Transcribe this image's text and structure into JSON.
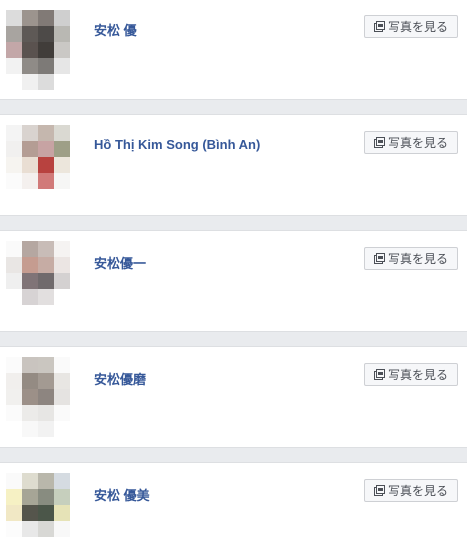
{
  "results": [
    {
      "name": "安松 優",
      "button_label": "写真を見る",
      "avatar_pixels": [
        "#dcdcdc",
        "#9c948e",
        "#817a76",
        "#cfcfcf",
        "#ffffff",
        "#a8a4a0",
        "#5e5956",
        "#4d4a48",
        "#b9b8b3",
        "#ffffff",
        "#c3a7a8",
        "#5a524f",
        "#413d3a",
        "#cac8c5",
        "#ffffff",
        "#f2f2f2",
        "#8f8b87",
        "#7d7a77",
        "#e6e6e6",
        "#ffffff",
        "#ffffff",
        "#f0f0f0",
        "#dcdcdc",
        "#ffffff",
        "#ffffff"
      ]
    },
    {
      "name": "Hồ Thị Kim Song (Bình An)",
      "button_label": "写真を見る",
      "avatar_pixels": [
        "#f4f4f4",
        "#d9d3cf",
        "#c5b7ae",
        "#dad9d2",
        "#ffffff",
        "#f1f0ef",
        "#b49d94",
        "#c7a3a3",
        "#9e9f87",
        "#ffffff",
        "#f6f4f0",
        "#e9ded3",
        "#b8423f",
        "#ece6dc",
        "#ffffff",
        "#fbfbfb",
        "#f4f0ee",
        "#d17a79",
        "#f6f6f5",
        "#ffffff",
        "#ffffff",
        "#ffffff",
        "#ffffff",
        "#ffffff",
        "#ffffff"
      ]
    },
    {
      "name": "安松優一",
      "button_label": "写真を見る",
      "avatar_pixels": [
        "#fafafa",
        "#b5a7a1",
        "#c8bcb7",
        "#f5f3f2",
        "#ffffff",
        "#e9e6e4",
        "#c59c90",
        "#c6aca4",
        "#ebe5e3",
        "#ffffff",
        "#efefef",
        "#807477",
        "#706a6c",
        "#d4d1d1",
        "#ffffff",
        "#ffffff",
        "#d7d3d4",
        "#e2dfdf",
        "#ffffff",
        "#ffffff",
        "#ffffff",
        "#ffffff",
        "#ffffff",
        "#ffffff",
        "#ffffff"
      ]
    },
    {
      "name": "安松優磨",
      "button_label": "写真を見る",
      "avatar_pixels": [
        "#fbfbfb",
        "#c9c4bf",
        "#cac6c0",
        "#fafafa",
        "#ffffff",
        "#f1efed",
        "#948b83",
        "#a39a92",
        "#e8e6e3",
        "#ffffff",
        "#f1f0ee",
        "#9c9088",
        "#8d8580",
        "#e5e3e1",
        "#ffffff",
        "#fbfbfb",
        "#ecebe9",
        "#e7e6e4",
        "#fafafa",
        "#ffffff",
        "#ffffff",
        "#f8f8f8",
        "#f2f2f2",
        "#ffffff",
        "#ffffff"
      ]
    },
    {
      "name": "安松 優美",
      "button_label": "写真を見る",
      "avatar_pixels": [
        "#fafafa",
        "#dedccf",
        "#b9b7ab",
        "#d5dbe1",
        "#ffffff",
        "#f6f1c4",
        "#a6a596",
        "#888c80",
        "#c6cfbd",
        "#ffffff",
        "#f1e8c5",
        "#55554c",
        "#4b5649",
        "#e6e3b7",
        "#ffffff",
        "#fcfcfc",
        "#e8e8e8",
        "#d8d8d5",
        "#f8f8f8",
        "#ffffff",
        "#ffffff",
        "#ffffff",
        "#ffffff",
        "#ffffff",
        "#ffffff"
      ]
    }
  ],
  "icons": {
    "photo_button_icon": "photos-icon"
  },
  "colors": {
    "name_link": "#365899",
    "page_background": "#e9ebee",
    "card_background": "#ffffff",
    "button_background": "#f6f7f9",
    "button_border": "#ced0d4",
    "button_text": "#4b4f56"
  }
}
